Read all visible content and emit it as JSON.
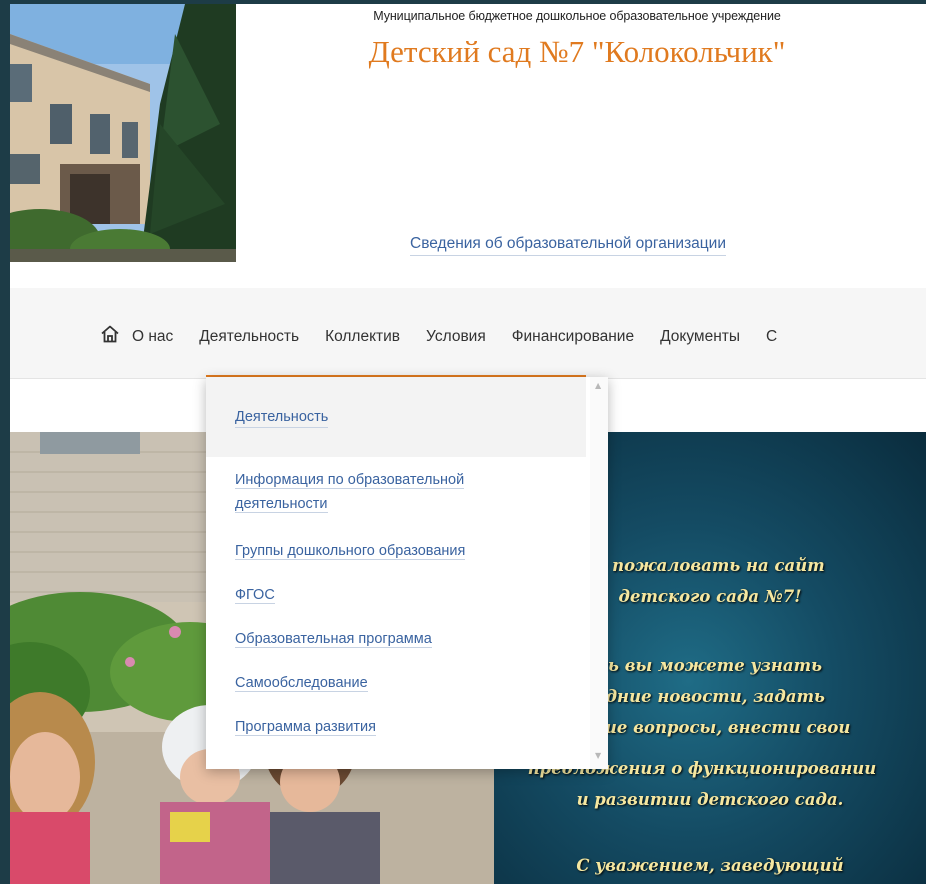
{
  "header": {
    "subtitle": "Муниципальное бюджетное дошкольное образовательное учреждение",
    "title": "Детский сад №7 \"Колокольчик\"",
    "info_link": "Сведения об образовательной организации"
  },
  "nav": {
    "home_icon": "home-icon",
    "items": [
      {
        "label": "О нас"
      },
      {
        "label": "Деятельность"
      },
      {
        "label": "Коллектив"
      },
      {
        "label": "Условия"
      },
      {
        "label": "Финансирование"
      },
      {
        "label": "Документы"
      },
      {
        "label": "С"
      }
    ],
    "active_color": "#e07a1f"
  },
  "dropdown": {
    "title": "Деятельность",
    "items": [
      {
        "line1": "Информация по образовательной",
        "line2": "деятельности"
      },
      {
        "label": "Группы дошкольного образования"
      },
      {
        "label": "ФГОС"
      },
      {
        "label": "Образовательная программа"
      },
      {
        "label": "Самообследование"
      },
      {
        "label": "Программа развития"
      }
    ]
  },
  "banner": {
    "lines": [
      "о пожаловать на сайт",
      "детского сада №7!",
      "сь вы можете узнать",
      "едние новости, задать",
      "ющие вопросы, внести свои",
      "предложения о функционировании",
      "и развитии детского сада.",
      "С уважением, заведующий"
    ]
  },
  "colors": {
    "link": "#3a63a0",
    "brand": "#e07a1f",
    "banner_text": "#f5e7a0",
    "outer_frame": "#1d3c47"
  }
}
